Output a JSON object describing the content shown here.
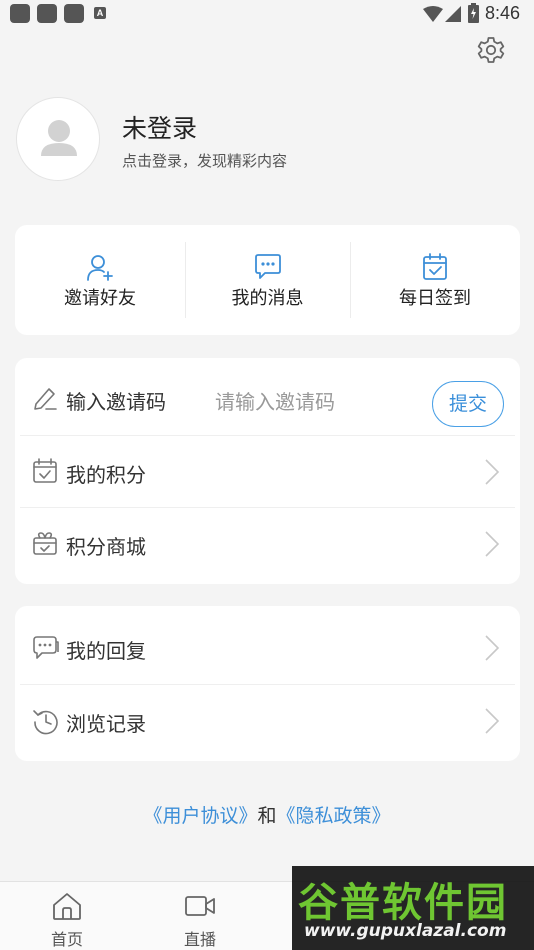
{
  "status_bar": {
    "time": "8:46",
    "notification_badge": "A"
  },
  "profile": {
    "username": "未登录",
    "subtitle": "点击登录，发现精彩内容"
  },
  "quick_actions": [
    {
      "label": "邀请好友",
      "icon": "add-user-icon"
    },
    {
      "label": "我的消息",
      "icon": "message-icon"
    },
    {
      "label": "每日签到",
      "icon": "calendar-check-icon"
    }
  ],
  "invite": {
    "label": "输入邀请码",
    "placeholder": "请输入邀请码",
    "submit_label": "提交"
  },
  "menu_group1": [
    {
      "label": "我的积分",
      "icon": "calendar-check-icon"
    },
    {
      "label": "积分商城",
      "icon": "gift-box-icon"
    }
  ],
  "menu_group2": [
    {
      "label": "我的回复",
      "icon": "chat-icon"
    },
    {
      "label": "浏览记录",
      "icon": "history-icon"
    }
  ],
  "policy": {
    "user_agreement": "《用户协议》",
    "and": "和",
    "privacy_policy": "《隐私政策》"
  },
  "tabbar": [
    {
      "label": "首页",
      "icon": "home-icon"
    },
    {
      "label": "直播",
      "icon": "video-icon"
    }
  ],
  "watermark": {
    "title": "谷普软件园",
    "url": "www.gupuxlazal.com"
  },
  "colors": {
    "accent": "#3d8fd8",
    "background": "#f4f4f4",
    "card": "#ffffff"
  }
}
